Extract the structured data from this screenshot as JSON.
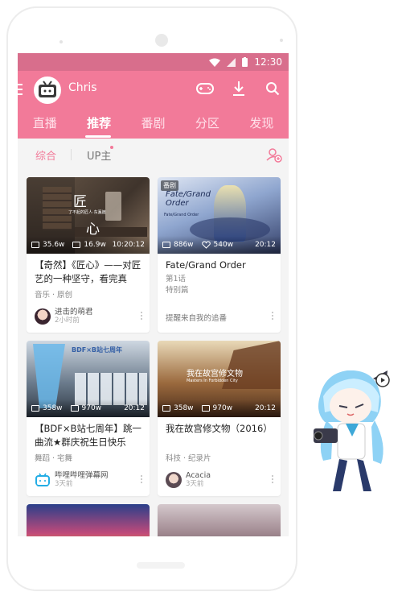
{
  "status_bar": {
    "time": "12:30"
  },
  "app_bar": {
    "username": "Chris",
    "icons": [
      "game-controller-icon",
      "download-icon",
      "search-icon"
    ]
  },
  "tabs": [
    "直播",
    "推荐",
    "番剧",
    "分区",
    "发现"
  ],
  "active_tab": "推荐",
  "subtabs": {
    "comprehensive": "综合",
    "up": "UP主"
  },
  "colors": {
    "accent": "#f27a99",
    "statusbar": "#d86e8c"
  },
  "cards": [
    {
      "thumb_caption1": "匠",
      "thumb_caption2": "心",
      "thumb_small": "了不起的匠人·东瀛篇",
      "views": "35.6w",
      "danmaku": "16.9w",
      "duration": "10:20:12",
      "title": "【奇然】《匠心》——对匠艺的一种坚守，看完真的..",
      "category": "音乐 · 原创",
      "uploader": "进击的萌君",
      "time": "2小时前"
    },
    {
      "thumb_caption1": "Fate/Grand Order",
      "thumb_small": "Fate/Grand Order",
      "ep_badge": "番剧",
      "views": "886w",
      "likes": "540w",
      "duration": "20:12",
      "title": "Fate/Grand Order",
      "episode": "第1话",
      "episode_title": "特别篇",
      "footer": "提醒来自我的追番"
    },
    {
      "thumb_caption1": "BDF×B站七周年",
      "views": "358w",
      "danmaku": "970w",
      "duration": "20:12",
      "title": "【BDF×B站七周年】跳一曲流★群庆祝生日快乐",
      "category": "舞蹈 · 宅舞",
      "uploader": "哔哩哔哩弹幕网",
      "time": "3天前"
    },
    {
      "thumb_caption1": "我在故宫修文物",
      "thumb_small": "Masters In Forbidden City",
      "views": "358w",
      "danmaku": "970w",
      "duration": "20:12",
      "title": "我在故宫修文物（2016）",
      "category": "科技 · 纪录片",
      "uploader": "Acacia",
      "time": "3天前"
    }
  ]
}
